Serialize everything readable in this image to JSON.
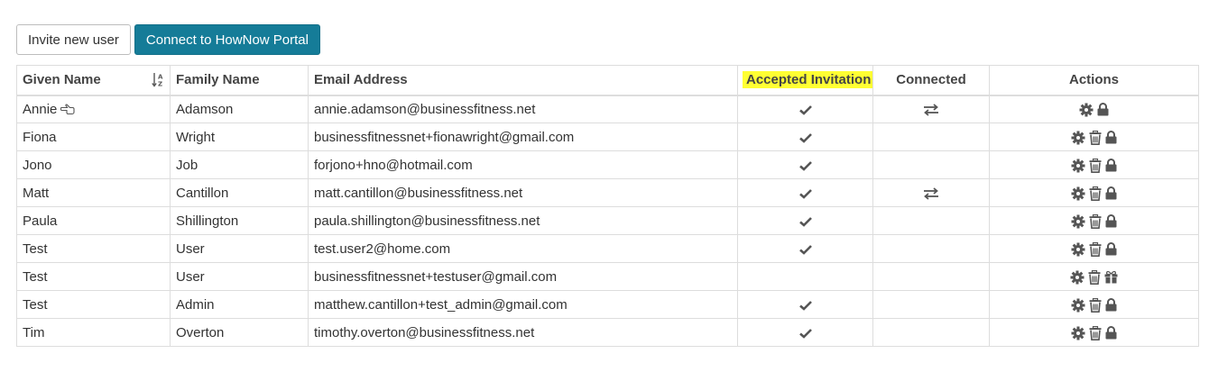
{
  "toolbar": {
    "invite_label": "Invite new user",
    "connect_label": "Connect to HowNow Portal"
  },
  "table": {
    "headers": {
      "given_name": "Given Name",
      "family_name": "Family Name",
      "email": "Email Address",
      "accepted": "Accepted Invitation",
      "connected": "Connected",
      "actions": "Actions"
    },
    "sort": {
      "column": "given_name",
      "direction": "ascending",
      "icon": "sort-alpha-asc-icon"
    },
    "highlight_color": "#ffff33",
    "rows": [
      {
        "given": "Annie",
        "family": "Adamson",
        "email": "annie.adamson@businessfitness.net",
        "accepted": true,
        "connected": true,
        "actions": [
          "gear-icon",
          "lock-icon"
        ],
        "current_user": true
      },
      {
        "given": "Fiona",
        "family": "Wright",
        "email": "businessfitnessnet+fionawright@gmail.com",
        "accepted": true,
        "connected": false,
        "actions": [
          "gear-icon",
          "trash-icon",
          "lock-icon"
        ]
      },
      {
        "given": "Jono",
        "family": "Job",
        "email": "forjono+hno@hotmail.com",
        "accepted": true,
        "connected": false,
        "actions": [
          "gear-icon",
          "trash-icon",
          "lock-icon"
        ]
      },
      {
        "given": "Matt",
        "family": "Cantillon",
        "email": "matt.cantillon@businessfitness.net",
        "accepted": true,
        "connected": true,
        "actions": [
          "gear-icon",
          "trash-icon",
          "lock-icon"
        ]
      },
      {
        "given": "Paula",
        "family": "Shillington",
        "email": "paula.shillington@businessfitness.net",
        "accepted": true,
        "connected": false,
        "actions": [
          "gear-icon",
          "trash-icon",
          "lock-icon"
        ]
      },
      {
        "given": "Test",
        "family": "User",
        "email": "test.user2@home.com",
        "accepted": true,
        "connected": false,
        "actions": [
          "gear-icon",
          "trash-icon",
          "lock-icon"
        ]
      },
      {
        "given": "Test",
        "family": "User",
        "email": "businessfitnessnet+testuser@gmail.com",
        "accepted": false,
        "connected": false,
        "actions": [
          "gear-icon",
          "trash-icon",
          "gift-icon"
        ]
      },
      {
        "given": "Test",
        "family": "Admin",
        "email": "matthew.cantillon+test_admin@gmail.com",
        "accepted": true,
        "connected": false,
        "actions": [
          "gear-icon",
          "trash-icon",
          "lock-icon"
        ]
      },
      {
        "given": "Tim",
        "family": "Overton",
        "email": "timothy.overton@businessfitness.net",
        "accepted": true,
        "connected": false,
        "actions": [
          "gear-icon",
          "trash-icon",
          "lock-icon"
        ]
      }
    ]
  }
}
